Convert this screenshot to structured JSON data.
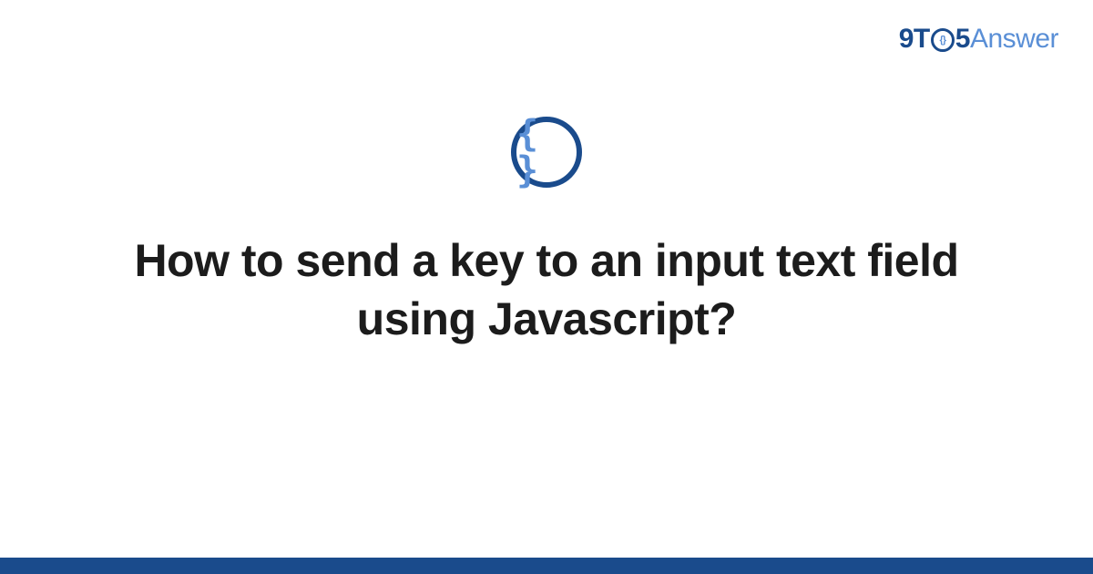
{
  "logo": {
    "part1": "9T",
    "circle_inner": "{}",
    "part2": "5",
    "part3": "Answer"
  },
  "badge": {
    "glyph": "{ }"
  },
  "title": "How to send a key to an input text field using Javascript?",
  "colors": {
    "brand_dark": "#1a4b8c",
    "brand_light": "#5a8fd6",
    "text": "#1c1c1c"
  }
}
